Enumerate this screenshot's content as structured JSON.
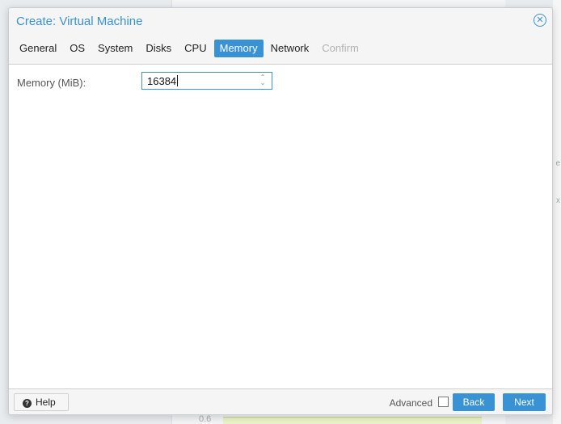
{
  "dialog": {
    "title": "Create: Virtual Machine",
    "close_icon": "close-circle-icon"
  },
  "tabs": [
    {
      "label": "General",
      "state": "normal"
    },
    {
      "label": "OS",
      "state": "normal"
    },
    {
      "label": "System",
      "state": "normal"
    },
    {
      "label": "Disks",
      "state": "normal"
    },
    {
      "label": "CPU",
      "state": "normal"
    },
    {
      "label": "Memory",
      "state": "active"
    },
    {
      "label": "Network",
      "state": "normal"
    },
    {
      "label": "Confirm",
      "state": "disabled"
    }
  ],
  "form": {
    "memory_label": "Memory (MiB):",
    "memory_value": "16384"
  },
  "footer": {
    "help_label": "Help",
    "advanced_label": "Advanced",
    "advanced_checked": false,
    "back_label": "Back",
    "next_label": "Next"
  },
  "background": {
    "tick_label": "0.6",
    "frag1": "e",
    "frag2": "x"
  },
  "colors": {
    "accent": "#3892d4",
    "panel_bg": "#ffffff",
    "dialog_bg": "#f5f5f5",
    "disabled_text": "#b3b3b3"
  }
}
